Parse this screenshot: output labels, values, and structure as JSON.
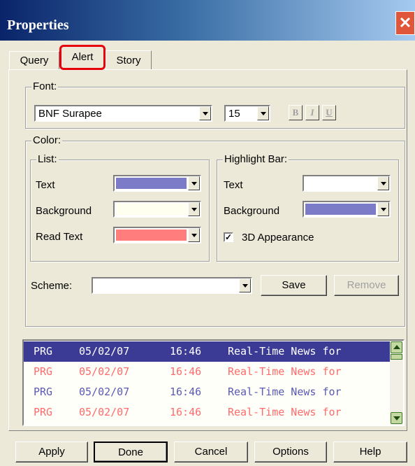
{
  "window": {
    "title": "Properties",
    "close_glyph": "✕"
  },
  "tabs": [
    {
      "label": "Query"
    },
    {
      "label": "Alert"
    },
    {
      "label": "Story"
    }
  ],
  "font": {
    "group_label": "Font:",
    "family": "BNF Surapee",
    "size": "15",
    "bold_label": "B",
    "italic_label": "I",
    "underline_label": "U"
  },
  "color": {
    "group_label": "Color:",
    "list": {
      "group_label": "List:",
      "text_label": "Text",
      "background_label": "Background",
      "read_text_label": "Read Text",
      "text_color": "#7b7bc8",
      "background_color": "#fffff0",
      "read_text_color": "#ff7d7d"
    },
    "highlight": {
      "group_label": "Highlight Bar:",
      "text_label": "Text",
      "background_label": "Background",
      "text_color": "#ffffff",
      "background_color": "#7b7bc8",
      "appearance_label": "3D Appearance",
      "appearance_checked": true
    },
    "scheme_label": "Scheme:",
    "scheme_value": "",
    "save_label": "Save",
    "remove_label": "Remove"
  },
  "preview_rows": [
    {
      "code": "PRG",
      "date": "05/02/07",
      "time": "16:46",
      "headline": "Real-Time News for",
      "style": "highlight"
    },
    {
      "code": "PRG",
      "date": "05/02/07",
      "time": "16:46",
      "headline": "Real-Time News for",
      "style": "read"
    },
    {
      "code": "PRG",
      "date": "05/02/07",
      "time": "16:46",
      "headline": "Real-Time News for",
      "style": "normal"
    },
    {
      "code": "PRG",
      "date": "05/02/07",
      "time": "16:46",
      "headline": "Real-Time News for",
      "style": "read"
    }
  ],
  "preview_colors": {
    "highlight_bg": "#3b3b96",
    "highlight_fg": "#ffffff",
    "read_fg": "#ff6b6b",
    "normal_fg": "#5a5ab4"
  },
  "footer": {
    "apply_label": "Apply",
    "done_label": "Done",
    "cancel_label": "Cancel",
    "options_label": "Options",
    "help_label": "Help"
  }
}
